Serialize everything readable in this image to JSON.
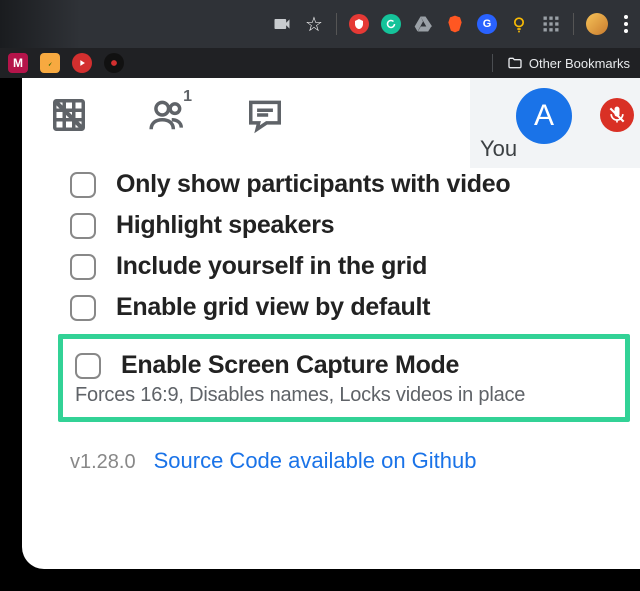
{
  "toolbar": {
    "icons": [
      "camera-icon",
      "star-icon",
      "adblock-icon",
      "grammarly-icon",
      "drive-icon",
      "brave-icon",
      "translate-icon",
      "lamp-icon",
      "apps-grid-icon",
      "profile-avatar-icon",
      "menu-dots-icon"
    ]
  },
  "bookmarks": {
    "left_chips": [
      "myntra-chip",
      "postman-chip",
      "youtube-music-chip",
      "dev-chip"
    ],
    "folder_label": "Other Bookmarks"
  },
  "tabs": {
    "layout_icon": "grid-off-icon",
    "people_icon": "people-icon",
    "people_count": "1",
    "chat_icon": "chat-icon"
  },
  "self_tile": {
    "label": "You",
    "avatar_letter": "A",
    "mic_state": "muted"
  },
  "options": [
    {
      "label": "Only show participants with video"
    },
    {
      "label": "Highlight speakers"
    },
    {
      "label": "Include yourself in the grid"
    },
    {
      "label": "Enable grid view by default"
    }
  ],
  "highlighted": {
    "label": "Enable Screen Capture Mode",
    "description": "Forces 16:9, Disables names, Locks videos in place"
  },
  "footer": {
    "version": "v1.28.0",
    "link_text": "Source Code available on Github"
  }
}
